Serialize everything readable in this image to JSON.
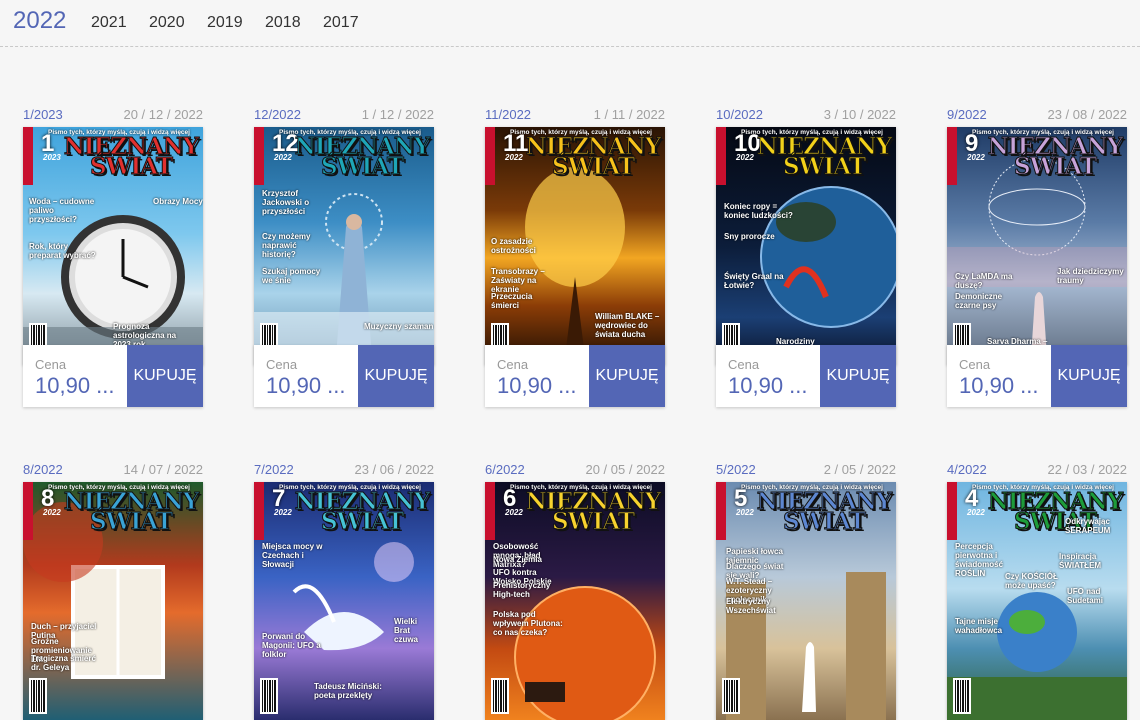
{
  "years": [
    "2022",
    "2021",
    "2020",
    "2019",
    "2018",
    "2017"
  ],
  "active_year": "2022",
  "price_label": "Cena",
  "buy_label": "KUPUJĘ",
  "colors": {
    "accent": "#5366b5",
    "issue_text": "#5a6cc0",
    "date_text": "#a0a0a0"
  },
  "magazine": {
    "title_line1": "NIEZNANY",
    "title_line2": "ŚWIAT",
    "tagline": "Pismo tych, którzy myślą, czują i widzą więcej"
  },
  "issues": [
    {
      "issue": "1/2023",
      "date": "20 / 12 / 2022",
      "price": "10,90 ...",
      "num": "1",
      "year": "2023",
      "headlines": [
        "Woda – cudowne paliwo przyszłości?",
        "Obrazy Mocy",
        "Rok, który preparat wybrać?",
        "Prognoza astrologiczna na 2023 rok"
      ]
    },
    {
      "issue": "12/2022",
      "date": "1 / 12 / 2022",
      "price": "10,90 ...",
      "num": "12",
      "year": "2022",
      "headlines": [
        "Krzysztof Jackowski o przyszłości",
        "Czy możemy naprawić historię?",
        "Szukaj pomocy we śnie",
        "Muzyczny szaman"
      ]
    },
    {
      "issue": "11/2022",
      "date": "1 / 11 / 2022",
      "price": "10,90 ...",
      "num": "11",
      "year": "2022",
      "headlines": [
        "O zasadzie ostrożności",
        "Transobrazy – Zaświaty na ekranie",
        "Przeczucia śmierci",
        "William BLAKE – wędrowiec do świata ducha"
      ]
    },
    {
      "issue": "10/2022",
      "date": "3 / 10 / 2022",
      "price": "10,90 ...",
      "num": "10",
      "year": "2022",
      "headlines": [
        "Koniec ropy = koniec ludzkości?",
        "Sny prorocze",
        "Święty Graal na Łotwie?",
        "Narodziny szamanki: Françoise Rambaud"
      ]
    },
    {
      "issue": "9/2022",
      "date": "23 / 08 / 2022",
      "price": "10,90 ...",
      "num": "9",
      "year": "2022",
      "headlines": [
        "Czy LaMDA ma duszę?",
        "Jak dziedziczymy traumy",
        "Demoniczne czarne psy",
        "Sarva Dharma – czyli JEDNOŚĆ ponad podziałem"
      ]
    },
    {
      "issue": "8/2022",
      "date": "14 / 07 / 2022",
      "price": "",
      "num": "8",
      "year": "2022",
      "headlines": [
        "Duch – przyjaciel Putina",
        "Groźne promieniowanie EM",
        "Tragiczna śmierć dr. Geleya"
      ]
    },
    {
      "issue": "7/2022",
      "date": "23 / 06 / 2022",
      "price": "",
      "num": "7",
      "year": "2022",
      "headlines": [
        "Miejsca mocy w Czechach i Słowacji",
        "Wielki Brat czuwa",
        "Porwani do Magonii: UFO a folklor",
        "Tadeusz Miciński: poeta przeklęty"
      ]
    },
    {
      "issue": "6/2022",
      "date": "20 / 05 / 2022",
      "price": "",
      "num": "6",
      "year": "2022",
      "headlines": [
        "Osobowość mnoga: błąd Matrixa?",
        "Nowa Ziemia",
        "UFO kontra Wojsko Polskie",
        "Prehistoryczny High-tech",
        "Polska pod wpływem Plutona: co nas czeka?"
      ]
    },
    {
      "issue": "5/2022",
      "date": "2 / 05 / 2022",
      "price": "",
      "num": "5",
      "year": "2022",
      "headlines": [
        "Papieski łowca tajemnic",
        "Dlaczego świat się wali?",
        "W.T. Stead – ezoteryczny społecznik",
        "Elektryczny Wszechświat"
      ]
    },
    {
      "issue": "4/2022",
      "date": "22 / 03 / 2022",
      "price": "",
      "num": "4",
      "year": "2022",
      "headlines": [
        "Odkrywając SERAPEUM",
        "Percepcja pierwotna i świadomość ROŚLIN",
        "Inspiracja ŚWIATŁEM",
        "Czy KOŚCIÓŁ może upaść?",
        "UFO nad Sudetami",
        "Tajne misje wahadłowca"
      ]
    }
  ]
}
